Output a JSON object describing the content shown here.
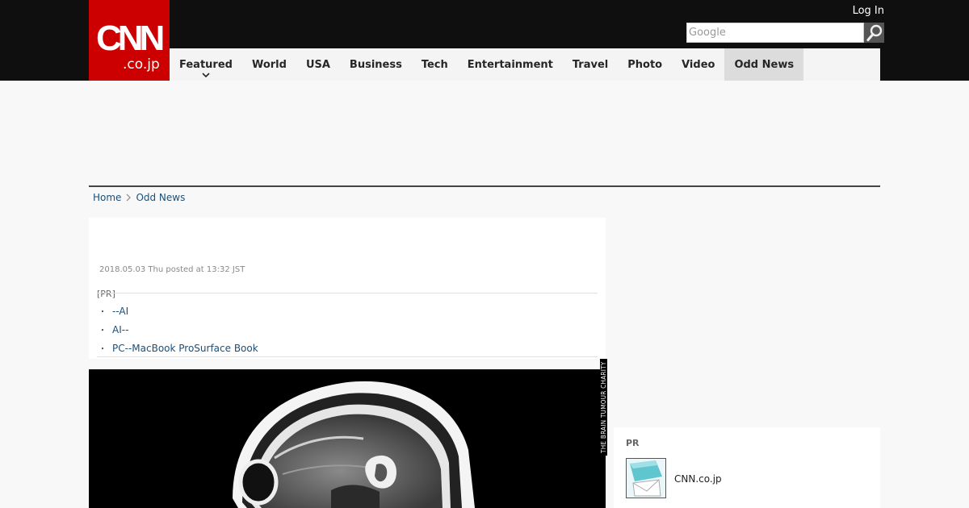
{
  "brand": {
    "logo_main": "CNN",
    "logo_sub": ".co.jp"
  },
  "header": {
    "login_label": "Log In",
    "search_placeholder": "Google"
  },
  "nav": {
    "items": [
      {
        "label": "Featured"
      },
      {
        "label": "World"
      },
      {
        "label": "USA"
      },
      {
        "label": "Business"
      },
      {
        "label": "Tech"
      },
      {
        "label": "Entertainment"
      },
      {
        "label": "Travel"
      },
      {
        "label": "Photo"
      },
      {
        "label": "Video"
      },
      {
        "label": "Odd News"
      }
    ],
    "active_label": "Odd News"
  },
  "breadcrumb": {
    "home": "Home",
    "section": "Odd News"
  },
  "article": {
    "posted": "2018.05.03 Thu posted at 13:32 JST",
    "pr_label": "[PR]",
    "pr_links": [
      {
        "label": "--AI"
      },
      {
        "label": "AI--"
      },
      {
        "label": "PC--MacBook ProSurface Book"
      }
    ],
    "photo_credit": "THE BRAIN TUMOUR CHARITY"
  },
  "sidebar": {
    "pr_label": "PR",
    "link_label": "CNN.co.jp"
  },
  "colors": {
    "brand_red": "#cc0000",
    "topbar": "#0f0f0f",
    "link": "#1a4f7a",
    "nav_active": "#dcdcdc"
  }
}
